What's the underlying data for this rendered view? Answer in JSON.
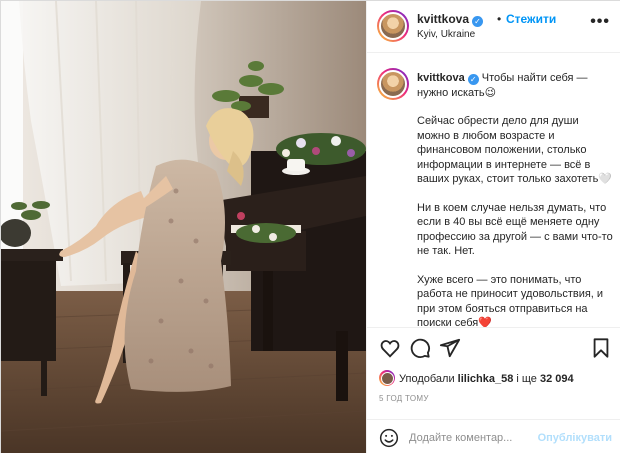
{
  "post": {
    "username": "kvittkova",
    "follow_label": "Стежити",
    "separator": "•",
    "location": "Kyiv, Ukraine",
    "more_label": "•••",
    "verified_icon": "verified-badge-icon"
  },
  "caption": {
    "username": "kvittkova",
    "first_line": "Чтобы найти себя —\nнужно искать😉",
    "paragraphs": [
      "Сейчас обрести дело для души можно в любом возрасте и финансовом положении, столько информации в интернете — всё в ваших руках, стоит только захотеть🤍",
      "Ни в коем случае нельзя думать, что если в 40 вы всё ещё меняете одну профессию за другой — с вами что-то не так. Нет.",
      "Хуже всего — это понимать, что работа не приносит удовольствия, и при этом бояться отправиться на поиски себя❤️"
    ]
  },
  "actions": {
    "like_icon": "heart-icon",
    "comment_icon": "comment-icon",
    "share_icon": "share-icon",
    "save_icon": "bookmark-icon"
  },
  "likes": {
    "prefix": "Уподобали",
    "user": "lilichka_58",
    "suffix": "і ще",
    "count": "32 094"
  },
  "timestamp": "5 ГОД ТОМУ",
  "comment": {
    "placeholder": "Додайте коментар...",
    "post_label": "Опублікувати",
    "emoji_icon": "smiley-icon"
  },
  "colors": {
    "link_blue": "#0095f6",
    "post_disabled": "#b2dffc",
    "text": "#262626",
    "muted": "#8e8e8e",
    "heart_red": "#ed4956"
  }
}
